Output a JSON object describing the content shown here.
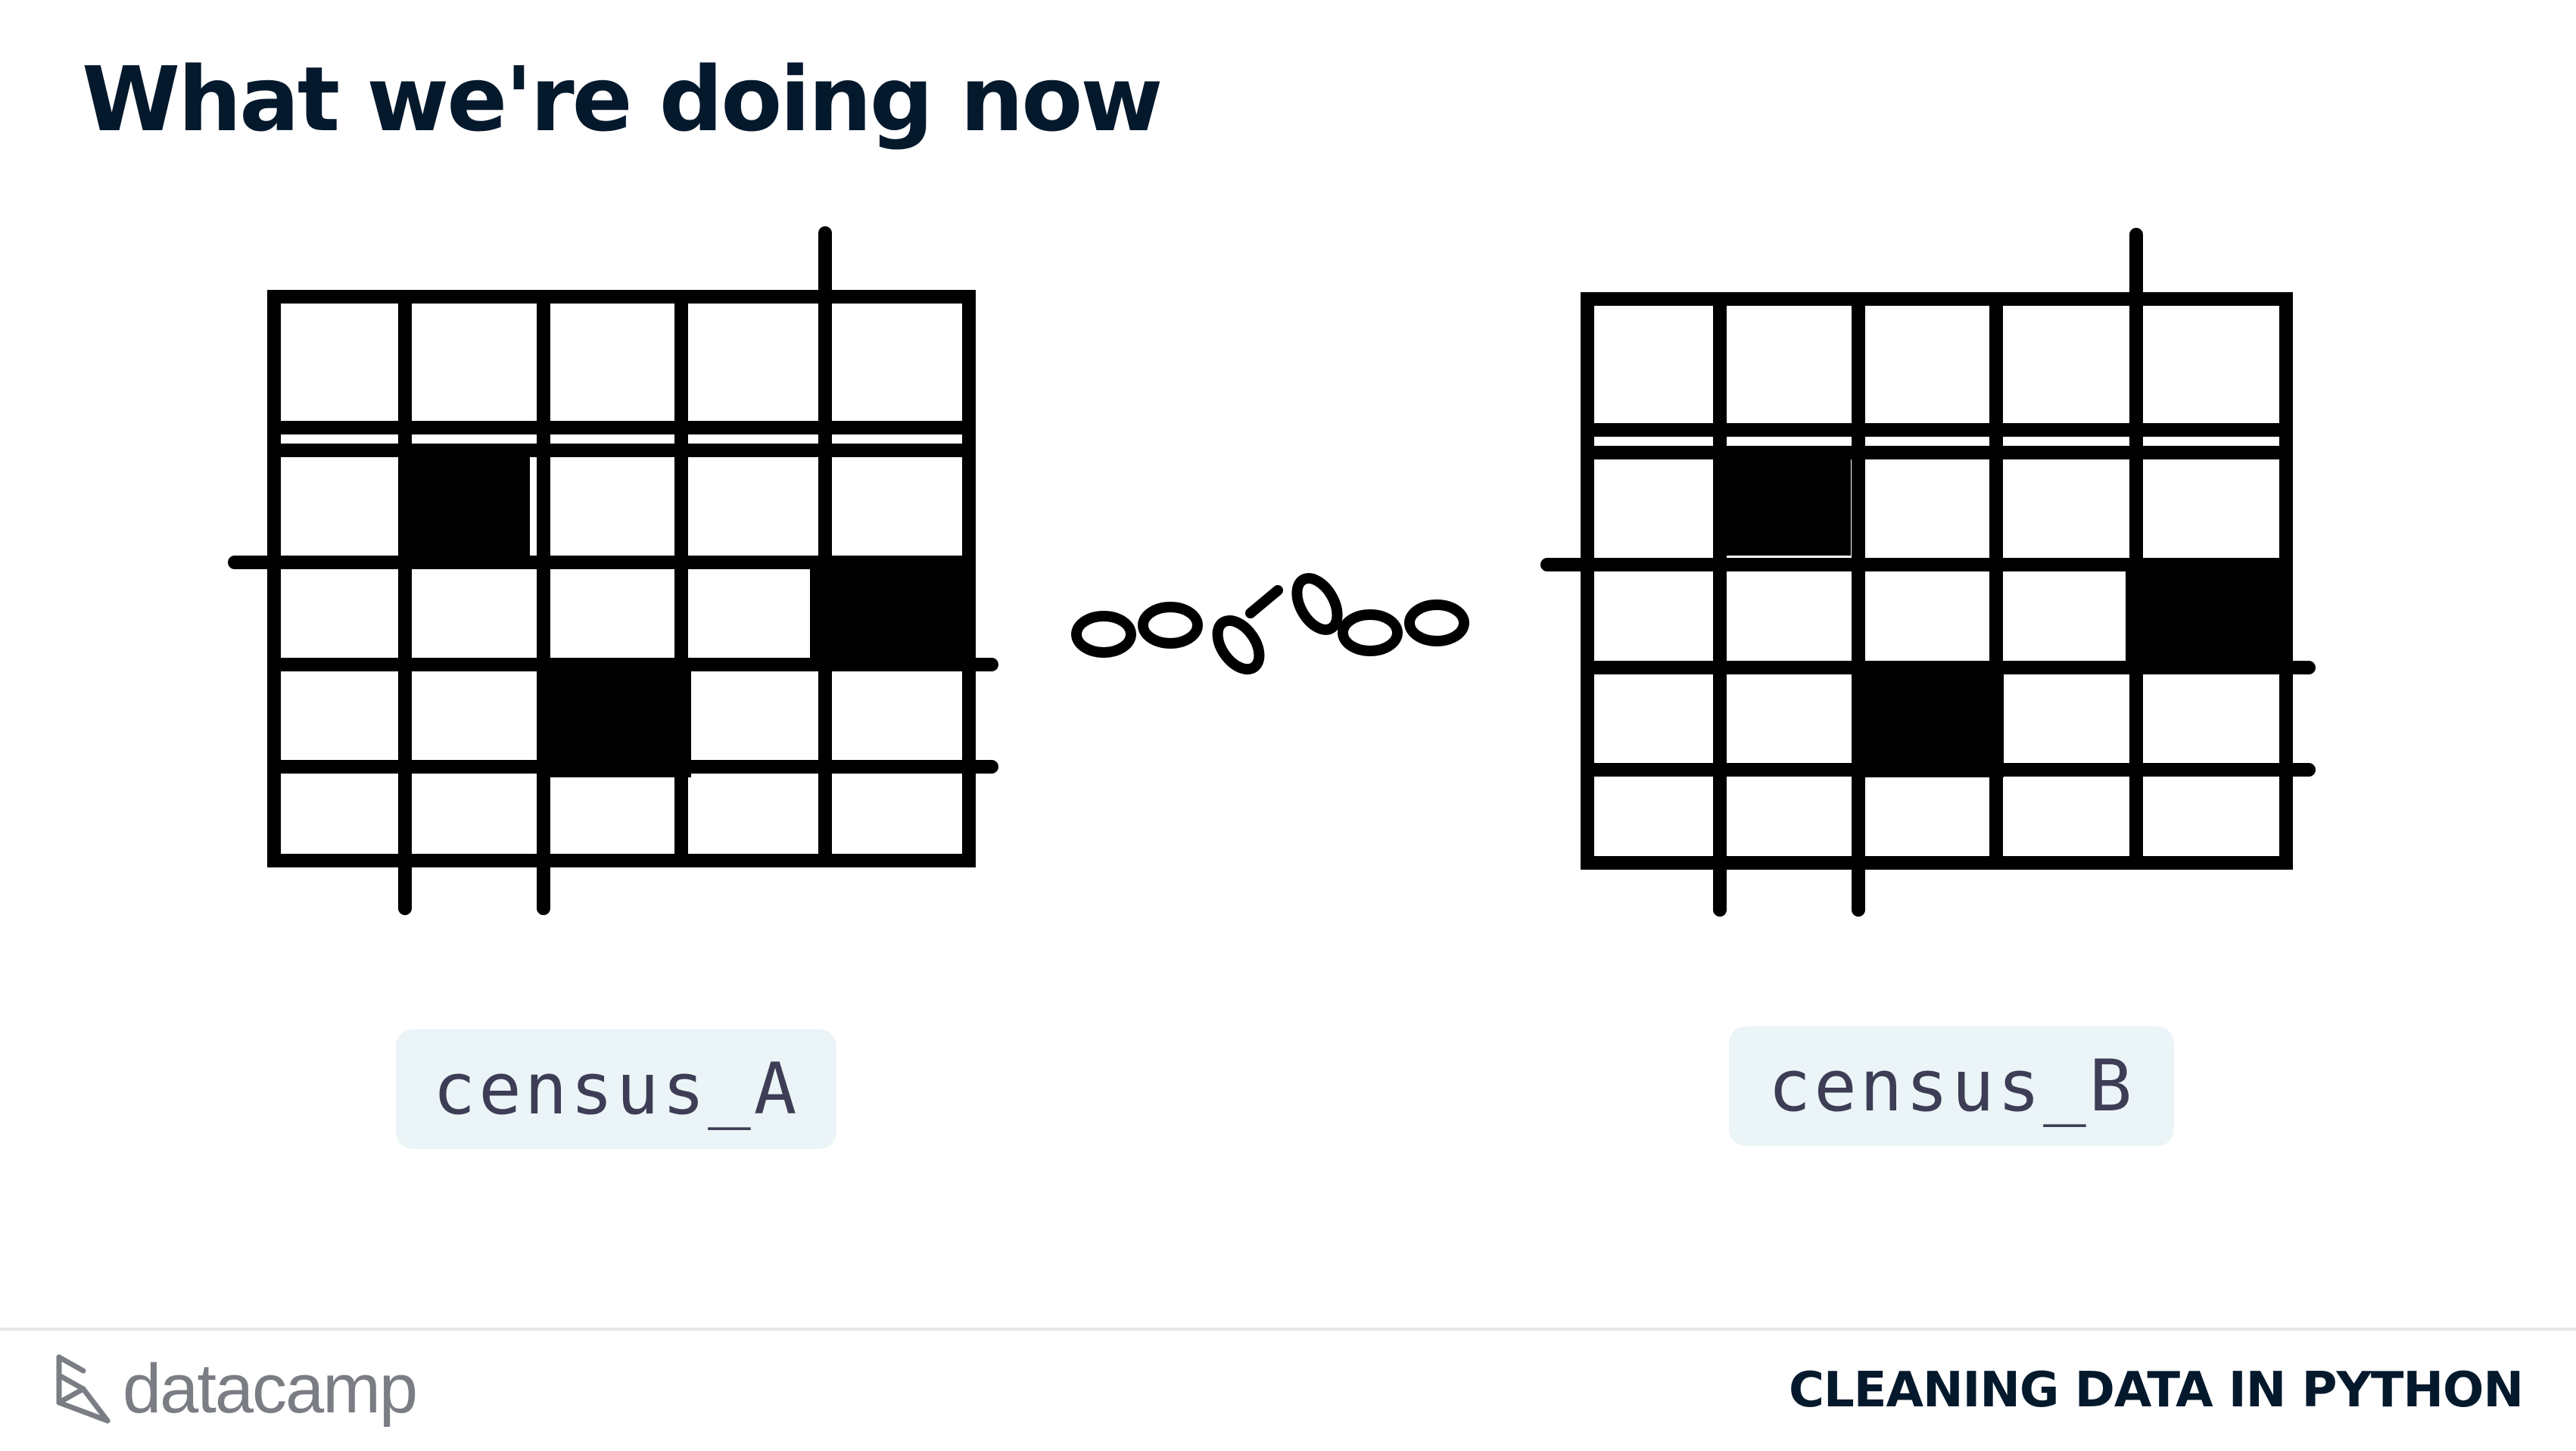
{
  "slide": {
    "title": "What we're doing now"
  },
  "tables": [
    {
      "label": "census_A"
    },
    {
      "label": "census_B"
    }
  ],
  "icons": {
    "table_left": "table-grid-icon",
    "table_right": "table-grid-icon",
    "link": "broken-chain-icon",
    "logo": "datacamp-logo-icon"
  },
  "footer": {
    "brand": "datacamp",
    "course": "CLEANING DATA IN PYTHON"
  },
  "colors": {
    "title": "#05192d",
    "label_bg": "#ebf4f7",
    "label_text": "#3d3d55",
    "logo": "#7b7d84"
  }
}
